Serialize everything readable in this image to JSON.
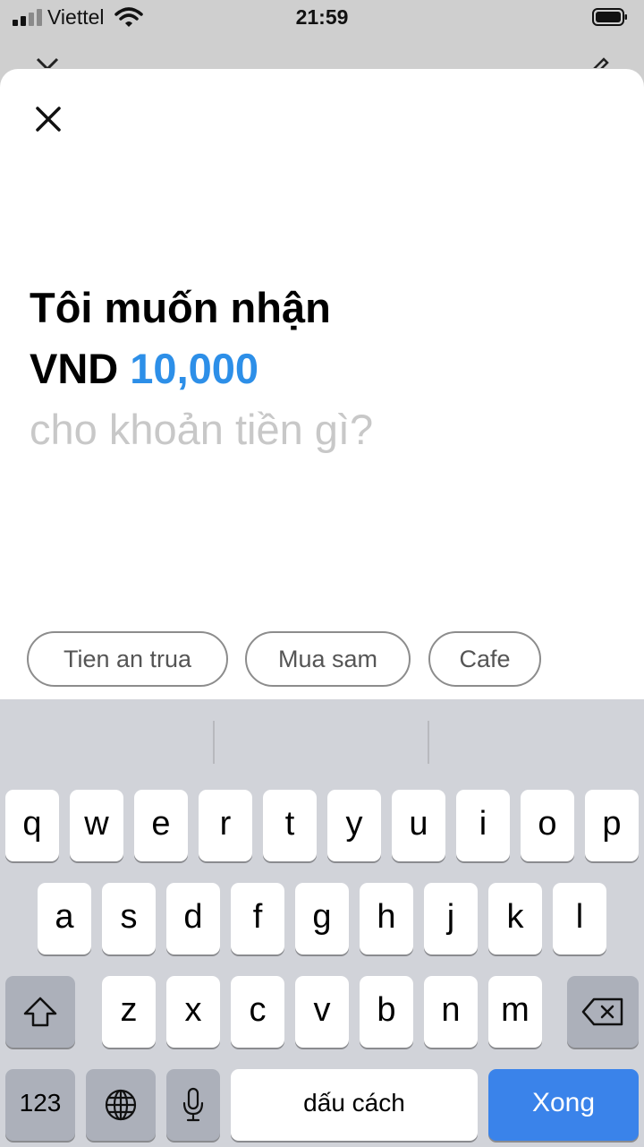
{
  "status_bar": {
    "carrier": "Viettel",
    "time": "21:59"
  },
  "prompt": {
    "line1": "Tôi muốn nhận",
    "currency": "VND",
    "amount": "10,000",
    "question": "cho khoản tiền gì?"
  },
  "suggestions": [
    "Tien an trua",
    "Mua sam",
    "Cafe"
  ],
  "keyboard": {
    "row1": [
      "q",
      "w",
      "e",
      "r",
      "t",
      "y",
      "u",
      "i",
      "o",
      "p"
    ],
    "row2": [
      "a",
      "s",
      "d",
      "f",
      "g",
      "h",
      "j",
      "k",
      "l"
    ],
    "row3": [
      "z",
      "x",
      "c",
      "v",
      "b",
      "n",
      "m"
    ],
    "numbers_label": "123",
    "space_label": "dấu cách",
    "done_label": "Xong"
  },
  "colors": {
    "accent": "#2d8fe8",
    "done_button": "#3a83ea",
    "placeholder_text": "#c8c8c8"
  },
  "icons": [
    "signal-icon",
    "wifi-icon",
    "battery-icon",
    "close-icon",
    "shift-icon",
    "backspace-icon",
    "globe-icon",
    "microphone-icon"
  ]
}
